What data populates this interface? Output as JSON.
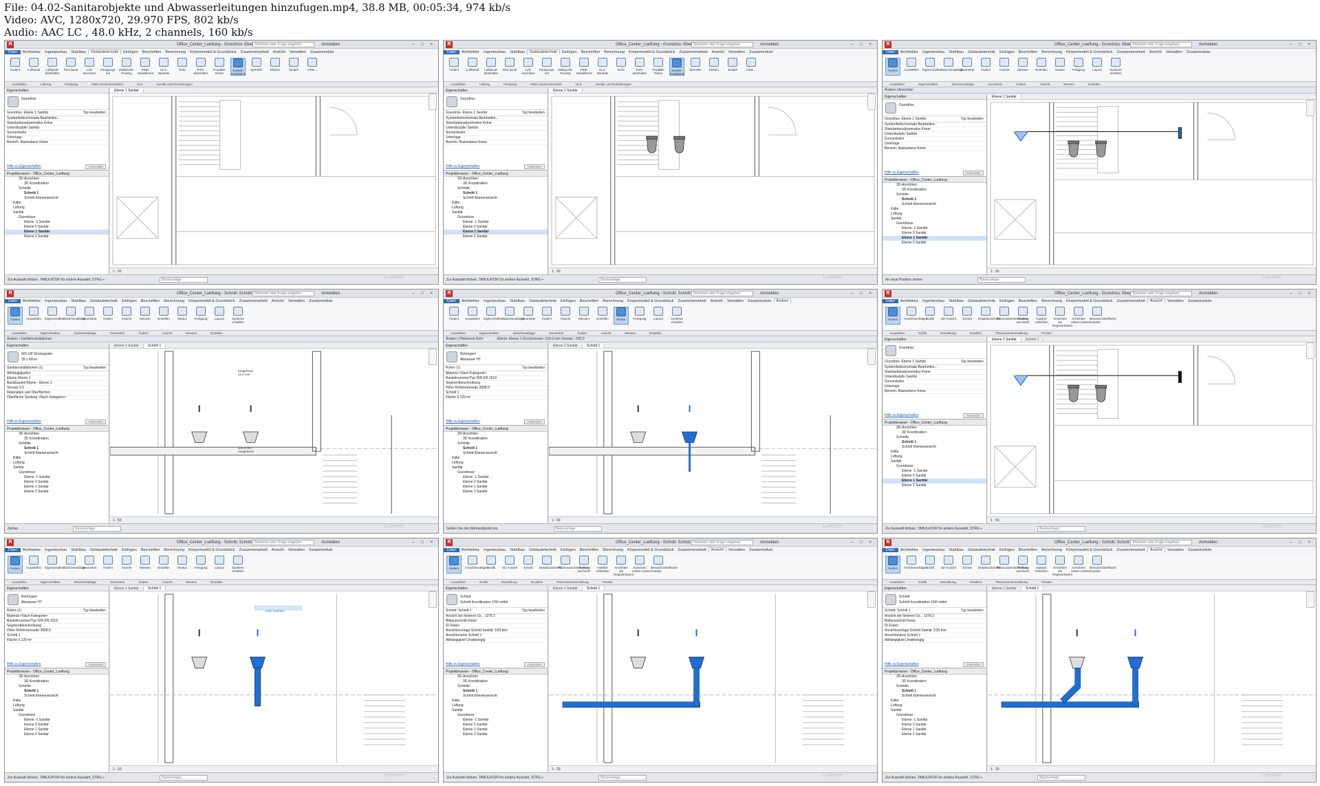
{
  "header": {
    "file": "File: 04.02-Sanitarobjekte und Abwasserleitungen hinzufugen.mp4, 38.8 MB, 00:05:34, 974 kb/s",
    "video": "Video: AVC, 1280x720, 29.970 FPS, 802 kb/s",
    "audio": "Audio: AAC LC , 48.0 kHz, 2 channels, 160 kb/s"
  },
  "app": {
    "title_plan": "Office_Center_Lueftung - Grundriss: Ebene 1 Sanitär",
    "title_section": "Office_Center_Lueftung - Schnitt: Schnitt 1",
    "search_placeholder": "Stichwort oder Frage eingeben",
    "account": "Anmelden",
    "window_buttons": "– □ ×",
    "tabs": [
      "Datei",
      "Architektur",
      "Ingenieurbau",
      "Stahlbau",
      "Gebäudetechnik",
      "Einfügen",
      "Beschriften",
      "Berechnung",
      "Körpermodell & Grundstück",
      "Zusammenarbeit",
      "Ansicht",
      "Verwalten",
      "Zusatzmodule",
      "Ändern"
    ],
    "ribbon_mep": [
      "Ändern",
      "Luftkanal",
      "Luftkanal-platzhalter",
      "Flex-kanal",
      "Luft-durchlass",
      "Fertigungs-teil",
      "Multipunkt-Routing",
      "P&ID Modellieren",
      "HLS-Bauteile",
      "Rohr",
      "Rohr-platzhalter",
      "Parallele Rohre",
      "Sanitär-installation",
      "Sprinkler",
      "Elektro",
      "Modell",
      "Arbei..."
    ],
    "ribbon_modify": [
      "Ändern",
      "Auswählen",
      "Eigenschaften",
      "Zwischenablage",
      "Geometrie",
      "Ändern",
      "Ansicht",
      "Messen",
      "Erstellen",
      "Modus",
      "Fertigung",
      "Layout",
      "Systeme erstellen"
    ],
    "ribbon_view": [
      "Ändern",
      "Ansichtsvorlagen",
      "Grafik",
      "3D-Ansicht",
      "Schnitt",
      "Detailausschnitt",
      "Planzusammenstellung",
      "Fenster wechseln",
      "Inaktive schließen",
      "Ansichten als Registerkarten",
      "Ansichten neben-/untereinander",
      "Benutzeroberfläche"
    ],
    "groups_mep": [
      "Auswählen",
      "Lüftung",
      "Fertigung",
      "P&ID-Zusammenarbeit",
      "HLS",
      "Sanitär und Rohrleitungen"
    ],
    "groups_modify": [
      "Auswählen",
      "Eigenschaften",
      "Zwischenablage",
      "Geometrie",
      "Ändern",
      "Ansicht",
      "Messen",
      "Erstellen"
    ],
    "groups_view": [
      "Auswählen",
      "Grafik",
      "Darstellung",
      "Erstellen",
      "Planzusammenstellung",
      "Fenster"
    ],
    "context_modify": "Ändern | Ansichten",
    "context_sanitary": "Ändern | Sanitärinstallationen",
    "context_pipe": "Ändern | Platzieren Rohr",
    "pipe_options": "Ebene: Ebene 1    Durchmesser: 100.0 mm    Versatz: -392.0",
    "view_tab_plan": "Ebene 1 Sanitär",
    "view_tab_section": "Schnitt 1",
    "scale_plan": "1 : 50",
    "scale_section": "1 : 20",
    "status_default": "Zur Auswahl klicken, TABULATOR für andere Auswahl, STRG +",
    "status_position": "An neue Position ziehen",
    "status_draw": "Ziehen",
    "status_pipe": "Geben Sie den Rohrendpunkt ein.",
    "base_view": "Basisvorlage",
    "watermark": "LinkedIn"
  },
  "properties": {
    "header": "Eigenschaften",
    "type_floor": "Grundriss",
    "type_wc": "WC-UP-Drückspüler",
    "type_wc_sub": "35 x 60cm",
    "type_pipe": "Rohrtypen",
    "type_pipe_sub": "Abwasser HT",
    "type_section": "Schnitt",
    "type_section_sub": "Schnitt Koordination 1/50 mittel",
    "selector_floor": "Grundriss: Ebene 1 Sanitär",
    "selector_wc": "Sanitärinstallationen (1)",
    "selector_pipe": "Rohre (1)",
    "selector_section": "Schnitt: Schnitt 1",
    "edit_type": "Typ bearbeiten",
    "rows_floor": [
      "Systemfarbschemata   Bearbeiten...",
      "Standardanalysemodus   Keine",
      "Unterdisziplin   Sanitär",
      "Sonnenbahn",
      "Unterlage",
      "Bereich: Basisebene   Keine"
    ],
    "rows_wc": [
      "Abhängigkeiten",
      "Ebene   Ebene 1",
      "Basisbauteil   Ebene : Ebene 1",
      "Versatz   0.0",
      "Materialien und Oberflächen",
      "Oberfläche Spülung   <Nach Kategorie>"
    ],
    "rows_pipe": [
      "Material   <Nach Kategorie>",
      "Bauteilnummer/Typ   DIN EN 1519",
      "Segmentbeschreibung",
      "Höhe Rohrinnenseite   2808.0",
      "Schnitt   1",
      "Fläche   0.129 m²"
    ],
    "rows_section": [
      "Ansicht der hinteren Gr...   1278.2",
      "Bildausschnitt   Keine",
      "ID-Daten",
      "Ansichtsvorlage   Schnitt Sanitär 1/20 fein",
      "Ansichtsname   Schnitt 1",
      "Abhängigkeit   Unabhängig"
    ],
    "help_link": "Hilfe zu Eigenschaften",
    "apply": "Anwenden"
  },
  "browser": {
    "items": [
      "Projektbrowser - Office_Center_Lueftung",
      "3D-Ansichten",
      "3D Koordination",
      "Schnitte",
      "Schnitt 1",
      "Schnitt Ebenenansicht",
      "Kälte",
      "Lüftung",
      "Sanitär",
      "Grundrisse",
      "Ebene -1 Sanitär",
      "Ebene 0 Sanitär",
      "Ebene 1 Sanitär",
      "Ebene 2 Sanitär"
    ]
  },
  "annotations": {
    "inlet": "Eingehend",
    "inlet_dim": "12.0 mm",
    "outlet": "Ausgehend",
    "outlet_dim": "100.0 mm",
    "pipe_tag": "Rohr erstellen"
  }
}
